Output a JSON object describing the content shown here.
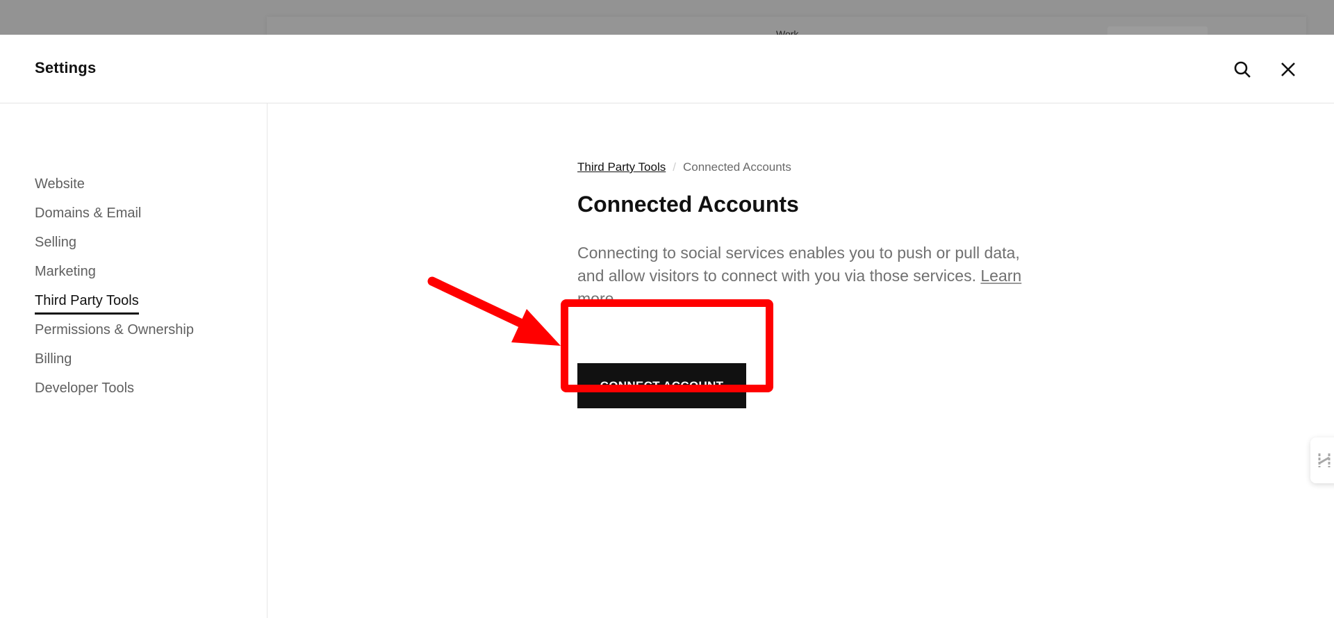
{
  "backdrop": {
    "ghost_text": "Work"
  },
  "header": {
    "title": "Settings",
    "search_icon": "search-icon",
    "close_icon": "close-icon"
  },
  "sidebar": {
    "items": [
      {
        "label": "Website",
        "active": false
      },
      {
        "label": "Domains & Email",
        "active": false
      },
      {
        "label": "Selling",
        "active": false
      },
      {
        "label": "Marketing",
        "active": false
      },
      {
        "label": "Third Party Tools",
        "active": true
      },
      {
        "label": "Permissions & Ownership",
        "active": false
      },
      {
        "label": "Billing",
        "active": false
      },
      {
        "label": "Developer Tools",
        "active": false
      }
    ]
  },
  "breadcrumb": {
    "parent": "Third Party Tools",
    "separator": "/",
    "current": "Connected Accounts"
  },
  "main": {
    "title": "Connected Accounts",
    "description": "Connecting to social services enables you to push or pull data, and allow visitors to connect with you via those services.",
    "learn_more": "Learn more",
    "connect_button": "CONNECT ACCOUNT"
  },
  "annotation": {
    "color": "#ff0000",
    "type": "arrow-and-box highlighting connect button"
  },
  "side_widget": {
    "icon": "h-logo-icon"
  },
  "colors": {
    "primary_button": "#111111",
    "text_muted": "#606060",
    "highlight": "#ff0000"
  }
}
